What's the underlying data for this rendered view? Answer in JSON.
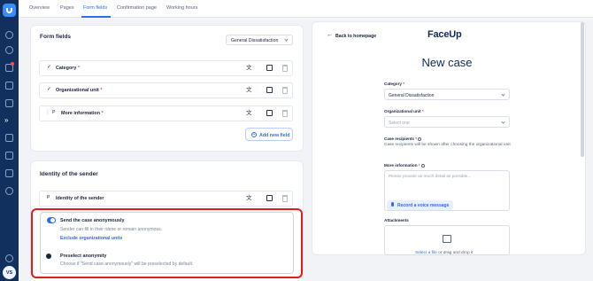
{
  "tabs": [
    "Overview",
    "Pages",
    "Form fields",
    "Confirmation page",
    "Working hours"
  ],
  "sidebar": {
    "icons": [
      "home-icon",
      "clock-icon",
      "inbox-icon",
      "clipboard-icon",
      "folder-icon",
      "arrow-right-icon",
      "chat-icon",
      "grid-icon",
      "puzzle-icon",
      "settings-icon"
    ],
    "user_initials": "VS"
  },
  "form_fields": {
    "title": "Form fields",
    "dropdown_value": "General Dissatisfaction",
    "fields": [
      {
        "label": "Category",
        "required": "*",
        "icon": "check-icon"
      },
      {
        "label": "Organizational unit",
        "required": "*",
        "icon": "check-icon"
      },
      {
        "label": "More information",
        "required": "*",
        "icon": "drag-icon"
      }
    ],
    "add_new_field": "Add new field"
  },
  "identity": {
    "title": "Identity of the sender",
    "field_label": "Identity of the sender",
    "option1_title": "Send the case anonymously",
    "option1_desc": "Sender can fill in their name or remain anonymous.",
    "option1_link": "Exclude organizational units",
    "option2_title": "Preselect anonymity",
    "option2_desc": "Choose if \"Send case anonymously\" will be preselected by default."
  },
  "preview": {
    "back": "Back to homepage",
    "brand": "FaceUp",
    "heading": "New case",
    "category_label": "Category",
    "category_value": "General Dissatisfaction",
    "org_label": "Organizational unit",
    "org_placeholder": "Select one",
    "recipients_label": "Case recipients",
    "recipients_text": "Case recipients will be shown after choosing the organizational unit",
    "more_info_label": "More information",
    "more_info_placeholder": "Please provide as much detail as possible...",
    "voice_button": "Record a voice message",
    "attachments_label": "Attachments",
    "attach_link": "Select a file",
    "attach_rest": "or drag and drop it"
  },
  "colors": {
    "accent": "#2d6df6",
    "sidebar": "#12305e",
    "highlight": "#e21b1b"
  }
}
